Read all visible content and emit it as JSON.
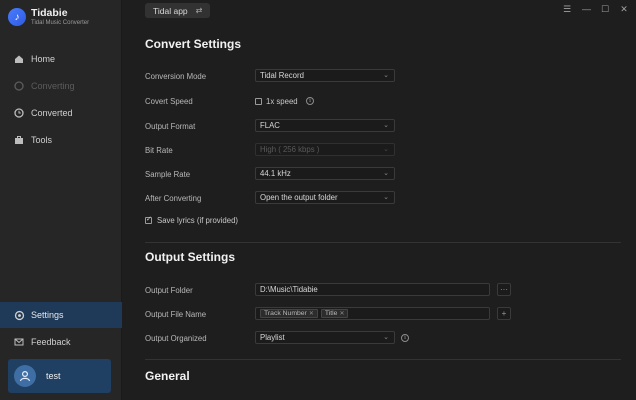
{
  "app": {
    "name": "Tidabie",
    "subtitle": "Tidal Music Converter",
    "source": "Tidal app"
  },
  "sidebar": {
    "items": [
      {
        "label": "Home",
        "icon": "home-icon",
        "state": "normal"
      },
      {
        "label": "Converting",
        "icon": "converting-icon",
        "state": "disabled"
      },
      {
        "label": "Converted",
        "icon": "clock-icon",
        "state": "normal"
      },
      {
        "label": "Tools",
        "icon": "toolbox-icon",
        "state": "normal"
      },
      {
        "label": "Settings",
        "icon": "gear-icon",
        "state": "active"
      },
      {
        "label": "Feedback",
        "icon": "mail-icon",
        "state": "normal"
      }
    ],
    "user": {
      "name": "test"
    }
  },
  "convert_settings": {
    "title": "Convert Settings",
    "conversion_mode": {
      "label": "Conversion Mode",
      "value": "Tidal Record"
    },
    "convert_speed": {
      "label": "Covert Speed",
      "option": "1x speed",
      "checked": false
    },
    "output_format": {
      "label": "Output Format",
      "value": "FLAC"
    },
    "bit_rate": {
      "label": "Bit Rate",
      "value": "High ( 256 kbps )"
    },
    "sample_rate": {
      "label": "Sample Rate",
      "value": "44.1 kHz"
    },
    "after_converting": {
      "label": "After Converting",
      "value": "Open the output folder"
    },
    "save_lyrics": {
      "label": "Save lyrics (if provided)",
      "checked": true
    }
  },
  "output_settings": {
    "title": "Output Settings",
    "output_folder": {
      "label": "Output Folder",
      "value": "D:\\Music\\Tidabie",
      "browse": "···"
    },
    "file_name": {
      "label": "Output File Name",
      "tags": [
        "Track Number",
        "Title"
      ],
      "add": "+"
    },
    "organized": {
      "label": "Output Organized",
      "value": "Playlist"
    }
  },
  "general": {
    "title": "General"
  },
  "colors": {
    "background": "#1e1e1e",
    "sidebar": "#262626",
    "active_nav": "#1f3a59",
    "user_card": "#1f3f63",
    "accent": "#4a7cff"
  }
}
